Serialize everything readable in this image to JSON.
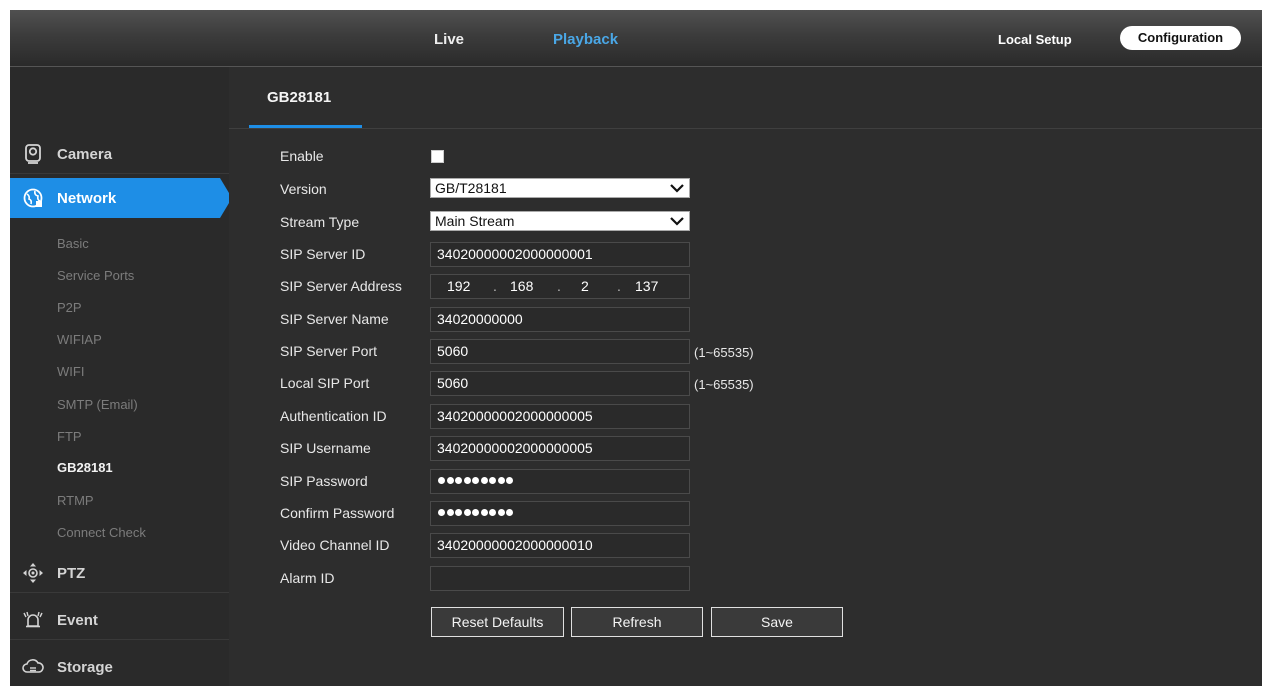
{
  "topnav": {
    "live": "Live",
    "playback": "Playback",
    "local_setup": "Local Setup",
    "configuration": "Configuration"
  },
  "sidebar": {
    "sections": {
      "camera": {
        "label": "Camera",
        "icon": "camera-icon"
      },
      "network": {
        "label": "Network",
        "icon": "network-globe-icon"
      },
      "ptz": {
        "label": "PTZ",
        "icon": "ptz-arrows-icon"
      },
      "event": {
        "label": "Event",
        "icon": "alarm-icon"
      },
      "storage": {
        "label": "Storage",
        "icon": "cloud-storage-icon"
      }
    },
    "network_items": [
      "Basic",
      "Service Ports",
      "P2P",
      "WIFIAP",
      "WIFI",
      "SMTP (Email)",
      "FTP",
      "GB28181",
      "RTMP",
      "Connect Check"
    ],
    "current_item": "GB28181"
  },
  "tab": {
    "title": "GB28181"
  },
  "form": {
    "enable_label": "Enable",
    "enable_checked": false,
    "version_label": "Version",
    "version_value": "GB/T28181",
    "stream_type_label": "Stream Type",
    "stream_type_value": "Main Stream",
    "sip_server_id_label": "SIP Server ID",
    "sip_server_id_value": "34020000002000000001",
    "sip_server_address_label": "SIP Server Address",
    "sip_server_address": [
      "192",
      "168",
      "2",
      "137"
    ],
    "sip_server_address_separator": ".",
    "sip_server_name_label": "SIP Server Name",
    "sip_server_name_value": "34020000000",
    "sip_server_port_label": "SIP Server Port",
    "sip_server_port_value": "5060",
    "sip_server_port_hint": "(1~65535)",
    "local_sip_port_label": "Local SIP Port",
    "local_sip_port_value": "5060",
    "local_sip_port_hint": "(1~65535)",
    "auth_id_label": "Authentication ID",
    "auth_id_value": "34020000002000000005",
    "sip_username_label": "SIP Username",
    "sip_username_value": "34020000002000000005",
    "sip_password_label": "SIP Password",
    "sip_password_mask_length": 9,
    "confirm_password_label": "Confirm Password",
    "confirm_password_mask_length": 9,
    "video_channel_id_label": "Video Channel ID",
    "video_channel_id_value": "34020000002000000010",
    "alarm_id_label": "Alarm ID",
    "alarm_id_value": ""
  },
  "buttons": {
    "reset_defaults": "Reset Defaults",
    "refresh": "Refresh",
    "save": "Save"
  },
  "colors": {
    "accent": "#1e8ee6",
    "playback_link": "#4aa7e6",
    "panel_bg": "#2d2d2d",
    "sidebar_bg": "#2a2a2a"
  }
}
